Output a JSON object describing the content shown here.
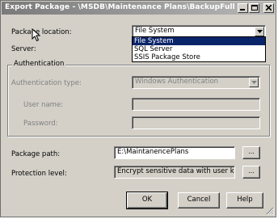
{
  "window": {
    "title": "Export Package - \\MSDB\\Maintenance Plans\\BackupFull",
    "controls": {
      "minimize": "_",
      "maximize": "□",
      "close": "×"
    }
  },
  "form": {
    "package_location_label": "Package location:",
    "package_location_value": "File System",
    "server_label": "Server:",
    "location_options": [
      "File System",
      "SQL Server",
      "SSIS Package Store"
    ],
    "selected_option_index": 0,
    "authentication": {
      "group_label": "Authentication",
      "type_label": "Authentication type:",
      "type_value": "Windows Authentication",
      "user_name_label": "User name:",
      "user_name_value": "",
      "password_label": "Password:",
      "password_value": ""
    },
    "package_path_label": "Package path:",
    "package_path_value": "E:\\MaintanencePlans",
    "protection_level_label": "Protection level:",
    "protection_level_value": "Encrypt sensitive data with user key",
    "browse_label": "..."
  },
  "buttons": {
    "ok": "OK",
    "cancel": "Cancel",
    "help": "Help"
  },
  "colors": {
    "selection": "#0a246a",
    "dialog_bg": "#d4d0c8"
  },
  "icons": [
    "minimize-icon",
    "maximize-icon",
    "close-icon",
    "dropdown-arrow-icon",
    "mouse-cursor-icon",
    "resize-grip-icon"
  ]
}
